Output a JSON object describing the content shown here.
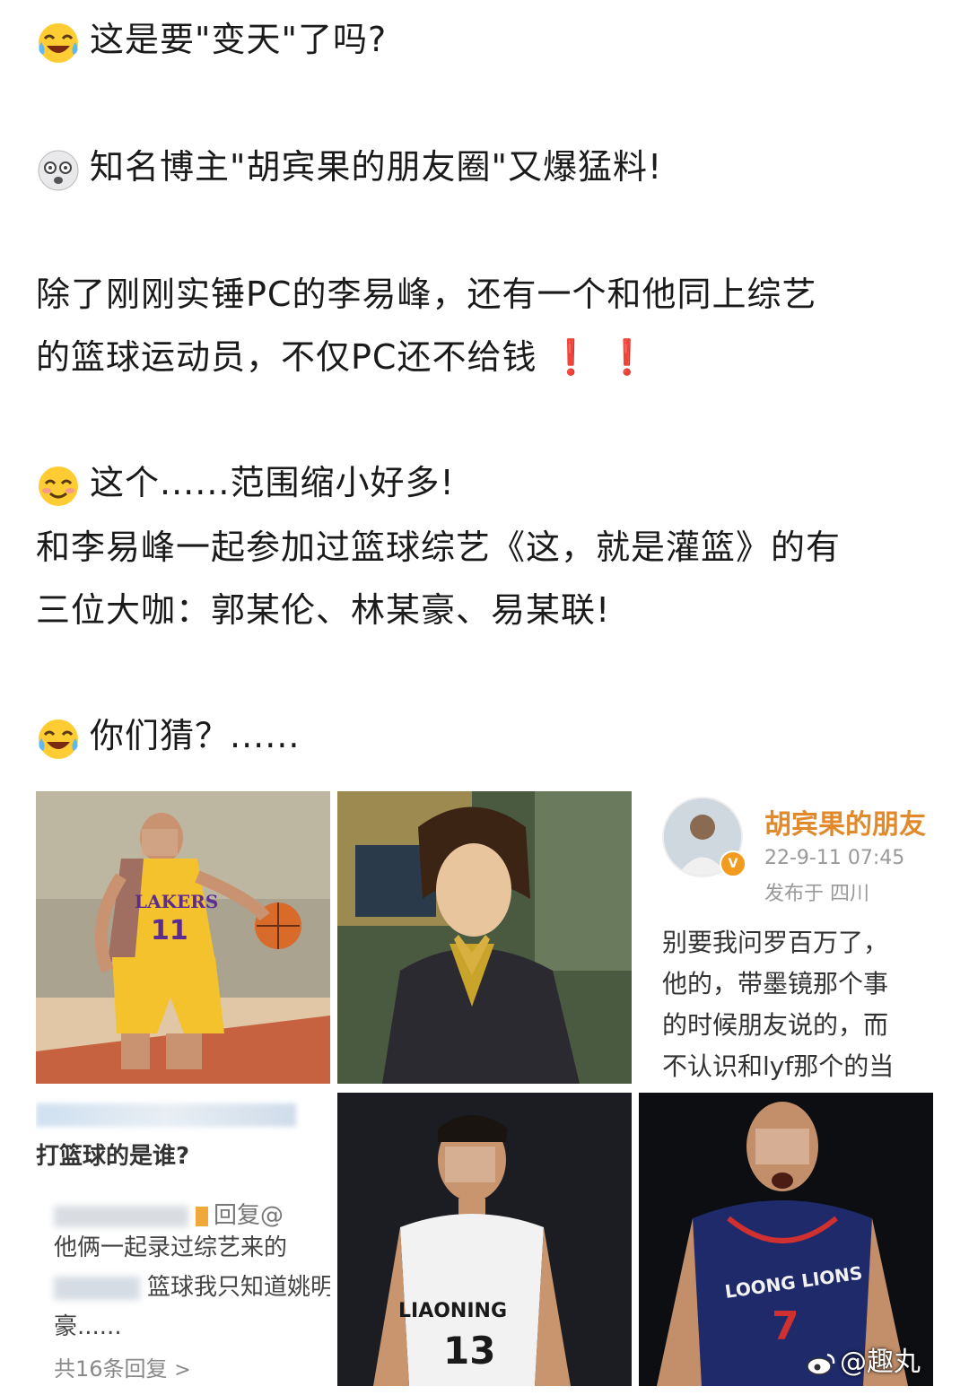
{
  "post": {
    "line1": "这是要\"变天\"了吗?",
    "line2": "知名博主\"胡宾果的朋友圈\"又爆猛料!",
    "line3a": "除了刚刚实锤PC的李易峰，还有一个和他同上综艺",
    "line3b": "的篮球运动员，不仅PC还不给钱",
    "exclaim": "❗ ❗",
    "line4": "这个......范围缩小好多!",
    "line5a": "和李易峰一起参加过篮球综艺《这，就是灌篮》的有",
    "line5b": "三位大咖：郭某伦、林某豪、易某联!",
    "line6": "你们猜？......",
    "emojis": [
      "crying-laughing-icon",
      "dizzy-face-icon",
      "smiling-blush-icon",
      "crying-laughing-icon"
    ]
  },
  "grid": {
    "cell3": {
      "username": "胡宾果的朋友",
      "meta_time": "22-9-11 07:45",
      "meta_loc": "发布于 四川",
      "body1": "别要我问罗百万了，",
      "body2": "他的，带墨镜那个事",
      "body3": "的时候朋友说的，而",
      "body4": "不认识和lyf那个的当"
    },
    "cell4": {
      "question": "打篮球的是谁?",
      "reply_to": "回复@",
      "reply1": "他俩一起录过综艺来的",
      "reply2": "篮球我只知道姚明",
      "reply3": "豪......",
      "more": "共16条回复",
      "chevron": ">"
    },
    "cell5": {
      "jersey_team": "LIAONING",
      "jersey_number": "13"
    },
    "cell6": {
      "jersey_team": "LOONG LIONS",
      "jersey_number": "7"
    },
    "cell1": {
      "jersey_team": "LAKERS",
      "jersey_number": "11"
    }
  },
  "watermark": {
    "text": "@趣丸"
  }
}
